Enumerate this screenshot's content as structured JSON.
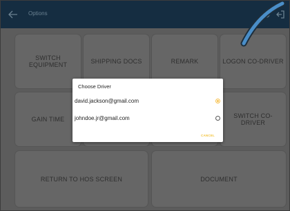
{
  "appbar": {
    "title": "Options"
  },
  "tiles": [
    {
      "label": "SWITCH EQUIPMENT"
    },
    {
      "label": "SHIPPING DOCS"
    },
    {
      "label": "REMARK"
    },
    {
      "label": "LOGON CO-DRIVER"
    },
    {
      "label": "GAIN TIME"
    },
    {
      "label": "SWITCH CO-DRIVER"
    },
    {
      "label": "RETURN TO HOS SCREEN"
    },
    {
      "label": "DOCUMENT"
    }
  ],
  "dialog": {
    "title": "Choose Driver",
    "options": [
      {
        "label": "david.jackson@gmail.com",
        "selected": true
      },
      {
        "label": "johndoe.jr@gmail.com",
        "selected": false
      }
    ],
    "cancel_label": "CANCEL"
  },
  "colors": {
    "appbar": "#152d41",
    "overlay": "#5c5c5c",
    "tile": "#666666",
    "accent": "#f7c04a",
    "arc": "#4a8ec8"
  },
  "icons": [
    "back-arrow-icon",
    "refresh-icon",
    "logout-icon"
  ]
}
